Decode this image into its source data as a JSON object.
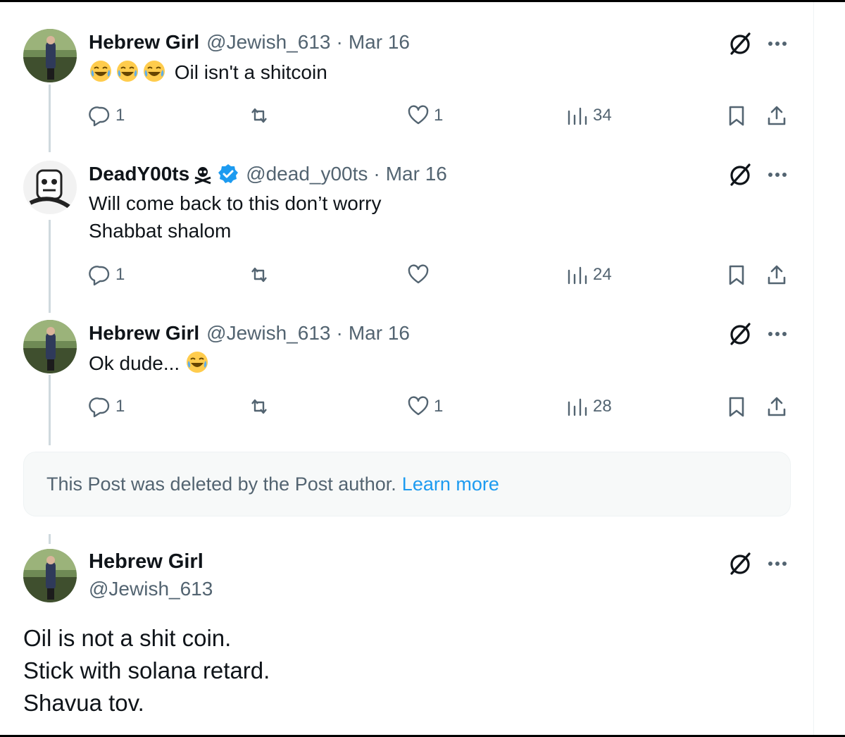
{
  "replies": [
    {
      "name": "Hebrew Girl",
      "handle": "@Jewish_613",
      "separator": "·",
      "date": "Mar 16",
      "text": "Oil isn't a shitcoin",
      "emoji_prefix": [
        "face-with-tears-of-joy",
        "face-with-tears-of-joy",
        "face-with-tears-of-joy"
      ],
      "replies_count": "1",
      "retweets_count": "",
      "likes_count": "1",
      "views_count": "34"
    },
    {
      "name": "DeadY00ts",
      "verified": true,
      "handle": "@dead_y00ts",
      "separator": "·",
      "date": "Mar 16",
      "text_lines": [
        "Will come back to this don’t worry",
        "Shabbat shalom"
      ],
      "replies_count": "1",
      "retweets_count": "",
      "likes_count": "",
      "views_count": "24"
    },
    {
      "name": "Hebrew Girl",
      "handle": "@Jewish_613",
      "separator": "·",
      "date": "Mar 16",
      "text": "Ok dude...",
      "emoji_suffix": "face-with-tears-of-joy",
      "replies_count": "1",
      "retweets_count": "",
      "likes_count": "1",
      "views_count": "28"
    }
  ],
  "deleted_notice": {
    "text": "This Post was deleted by the Post author.",
    "link": "Learn more"
  },
  "main_post": {
    "name": "Hebrew Girl",
    "handle": "@Jewish_613",
    "text_lines": [
      "Oil is not a shit coin.",
      "Stick with solana retard.",
      "Shavua tov."
    ]
  },
  "colors": {
    "text_primary": "#0f1419",
    "text_secondary": "#536471",
    "link": "#1d9bf0",
    "verified": "#1d9bf0",
    "thread_line": "#cfd9de"
  }
}
